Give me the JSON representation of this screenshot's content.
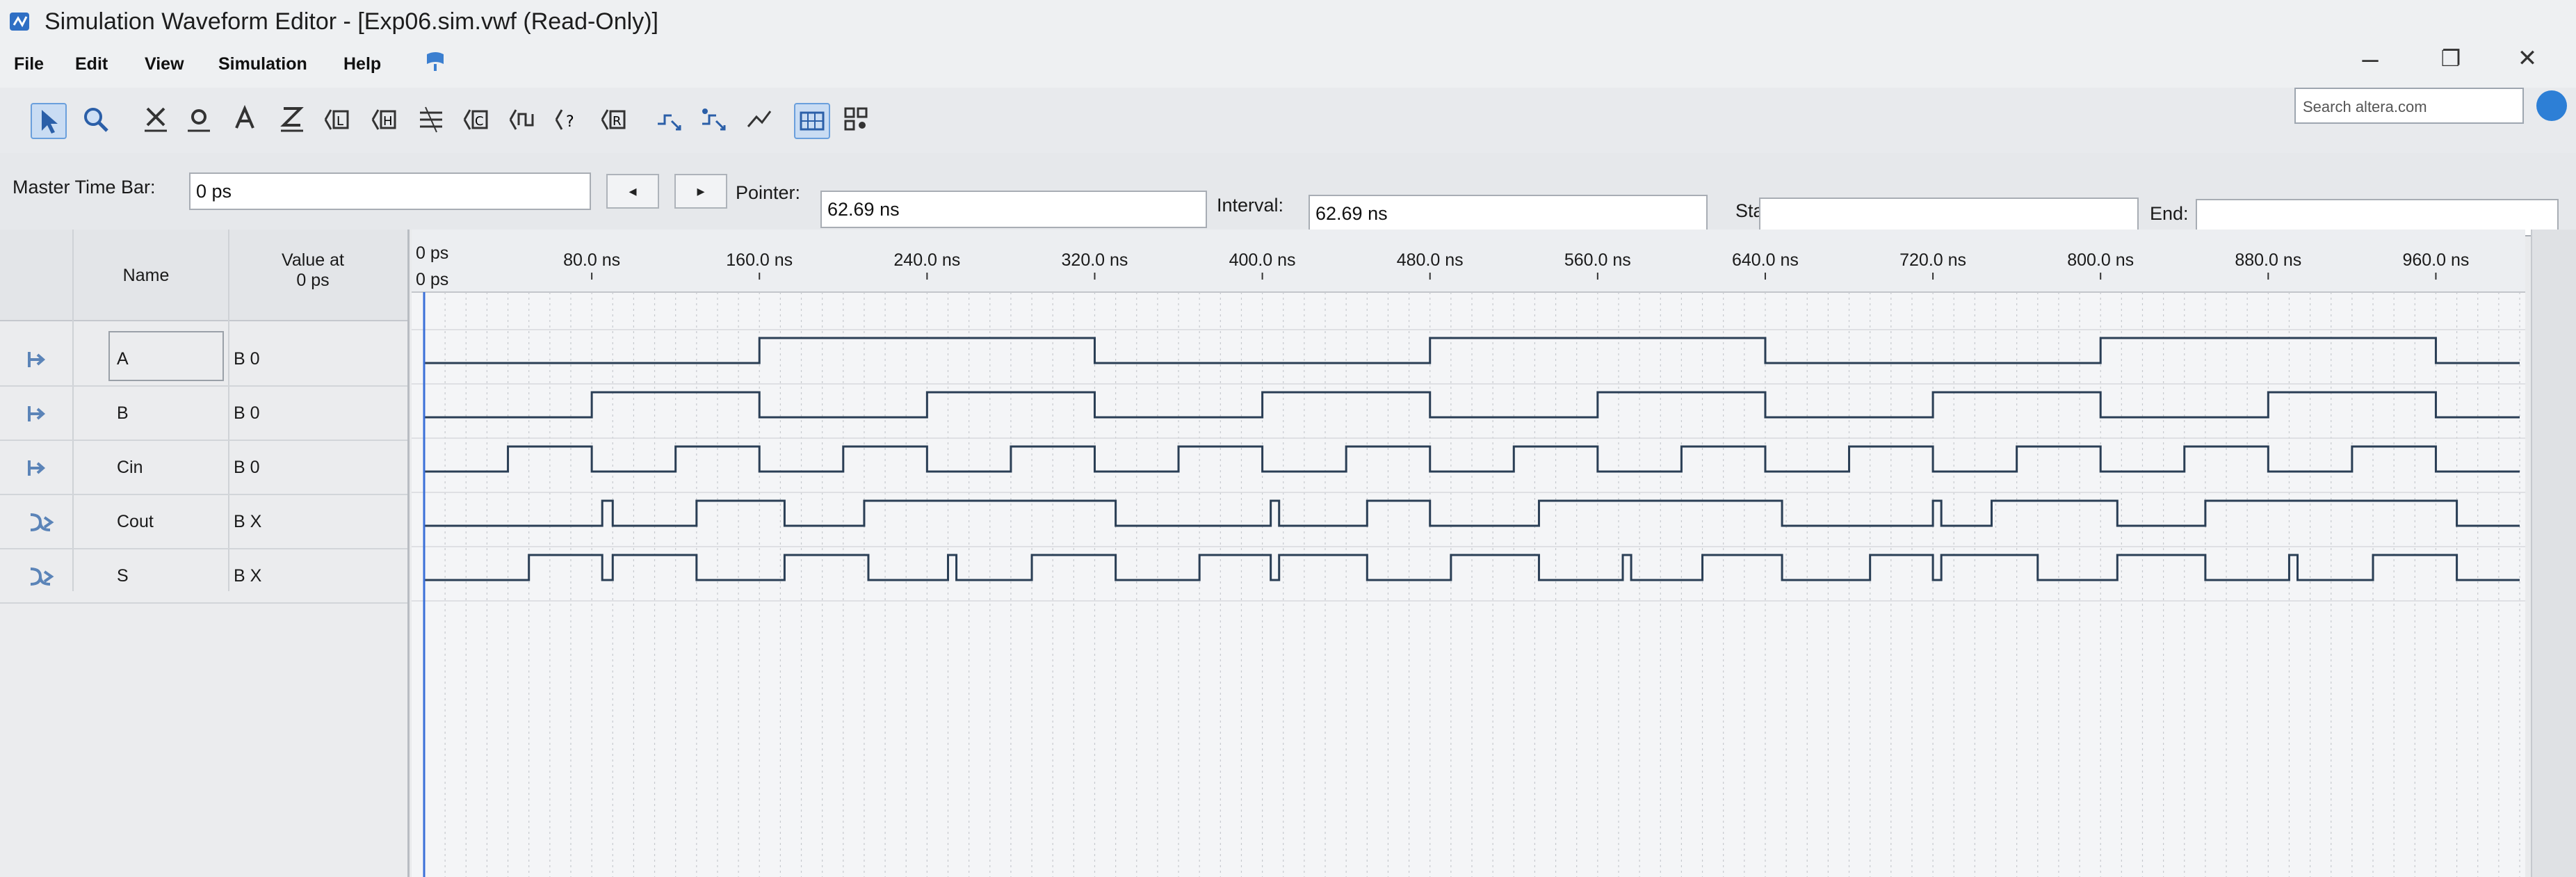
{
  "window": {
    "title": "Simulation Waveform Editor - [Exp06.sim.vwf (Read-Only)]",
    "minimize": "–",
    "restore": "❐",
    "close": "✕"
  },
  "menu": [
    "File",
    "Edit",
    "View",
    "Simulation",
    "Help"
  ],
  "toolbar": {
    "icons": [
      "selection-tool-icon",
      "zoom-tool-icon",
      "forcing-unknown-icon",
      "forcing-low-icon",
      "forcing-high-icon",
      "high-impedance-icon",
      "weak-low-icon",
      "weak-high-icon",
      "invert-icon",
      "count-value-icon",
      "clock-icon",
      "random-values-icon",
      "arbitrary-value-icon",
      "functional-simulation-icon",
      "timing-simulation-icon",
      "netlist-icon",
      "snap-to-grid-icon",
      "grid-settings-icon"
    ],
    "search_placeholder": "Search altera.com"
  },
  "timebar": {
    "master_label": "Master Time Bar:",
    "master_value": "0 ps",
    "pointer_label": "Pointer:",
    "pointer_value": "62.69 ns",
    "interval_label": "Interval:",
    "interval_value": "62.69 ns",
    "start_label": "Start:",
    "start_value": "",
    "end_label": "End:",
    "end_value": "",
    "prev_symbol": "◂",
    "next_symbol": "▸"
  },
  "table": {
    "name_header": "Name",
    "value_header_line1": "Value at",
    "value_header_line2": "0 ps"
  },
  "signals": [
    {
      "name": "A",
      "value": "B 0",
      "type": "input"
    },
    {
      "name": "B",
      "value": "B 0",
      "type": "input"
    },
    {
      "name": "Cin",
      "value": "B 0",
      "type": "input"
    },
    {
      "name": "Cout",
      "value": "B X",
      "type": "output"
    },
    {
      "name": "S",
      "value": "B X",
      "type": "output"
    }
  ],
  "timeline": {
    "start_label": "0 ps",
    "cursor_label": "0 ps",
    "ticks": [
      "80.0 ns",
      "160.0 ns",
      "240.0 ns",
      "320.0 ns",
      "400.0 ns",
      "480.0 ns",
      "560.0 ns",
      "640.0 ns",
      "720.0 ns",
      "800.0 ns",
      "880.0 ns",
      "960.0 ns"
    ]
  },
  "chart_data": {
    "type": "line",
    "x_unit": "ns",
    "x_range": [
      0,
      1000
    ],
    "series": [
      {
        "name": "A",
        "edges": [
          [
            0,
            0
          ],
          [
            160,
            1
          ],
          [
            320,
            0
          ],
          [
            480,
            1
          ],
          [
            640,
            0
          ],
          [
            800,
            1
          ],
          [
            960,
            0
          ]
        ]
      },
      {
        "name": "B",
        "edges": [
          [
            0,
            0
          ],
          [
            80,
            1
          ],
          [
            160,
            0
          ],
          [
            240,
            1
          ],
          [
            320,
            0
          ],
          [
            400,
            1
          ],
          [
            480,
            0
          ],
          [
            560,
            1
          ],
          [
            640,
            0
          ],
          [
            720,
            1
          ],
          [
            800,
            0
          ],
          [
            880,
            1
          ],
          [
            960,
            0
          ]
        ]
      },
      {
        "name": "Cin",
        "edges": [
          [
            0,
            0
          ],
          [
            40,
            1
          ],
          [
            80,
            0
          ],
          [
            120,
            1
          ],
          [
            160,
            0
          ],
          [
            200,
            1
          ],
          [
            240,
            0
          ],
          [
            280,
            1
          ],
          [
            320,
            0
          ],
          [
            360,
            1
          ],
          [
            400,
            0
          ],
          [
            440,
            1
          ],
          [
            480,
            0
          ],
          [
            520,
            1
          ],
          [
            560,
            0
          ],
          [
            600,
            1
          ],
          [
            640,
            0
          ],
          [
            680,
            1
          ],
          [
            720,
            0
          ],
          [
            760,
            1
          ],
          [
            800,
            0
          ],
          [
            840,
            1
          ],
          [
            880,
            0
          ],
          [
            920,
            1
          ],
          [
            960,
            0
          ]
        ]
      },
      {
        "name": "Cout",
        "edges": [
          [
            0,
            0
          ],
          [
            85,
            1
          ],
          [
            90,
            0
          ],
          [
            130,
            1
          ],
          [
            172,
            0
          ],
          [
            210,
            1
          ],
          [
            330,
            0
          ],
          [
            404,
            1
          ],
          [
            408,
            0
          ],
          [
            450,
            1
          ],
          [
            480,
            0
          ],
          [
            532,
            1
          ],
          [
            648,
            0
          ],
          [
            720,
            1
          ],
          [
            724,
            0
          ],
          [
            748,
            1
          ],
          [
            808,
            0
          ],
          [
            850,
            1
          ],
          [
            970,
            0
          ]
        ]
      },
      {
        "name": "S",
        "edges": [
          [
            0,
            0
          ],
          [
            50,
            1
          ],
          [
            85,
            0
          ],
          [
            90,
            1
          ],
          [
            130,
            0
          ],
          [
            172,
            1
          ],
          [
            212,
            0
          ],
          [
            250,
            1
          ],
          [
            254,
            0
          ],
          [
            290,
            1
          ],
          [
            330,
            0
          ],
          [
            370,
            1
          ],
          [
            404,
            0
          ],
          [
            408,
            1
          ],
          [
            450,
            0
          ],
          [
            490,
            1
          ],
          [
            532,
            0
          ],
          [
            572,
            1
          ],
          [
            576,
            0
          ],
          [
            610,
            1
          ],
          [
            648,
            0
          ],
          [
            690,
            1
          ],
          [
            720,
            0
          ],
          [
            724,
            1
          ],
          [
            770,
            0
          ],
          [
            808,
            1
          ],
          [
            850,
            0
          ],
          [
            890,
            1
          ],
          [
            894,
            0
          ],
          [
            930,
            1
          ],
          [
            970,
            0
          ]
        ]
      }
    ]
  }
}
